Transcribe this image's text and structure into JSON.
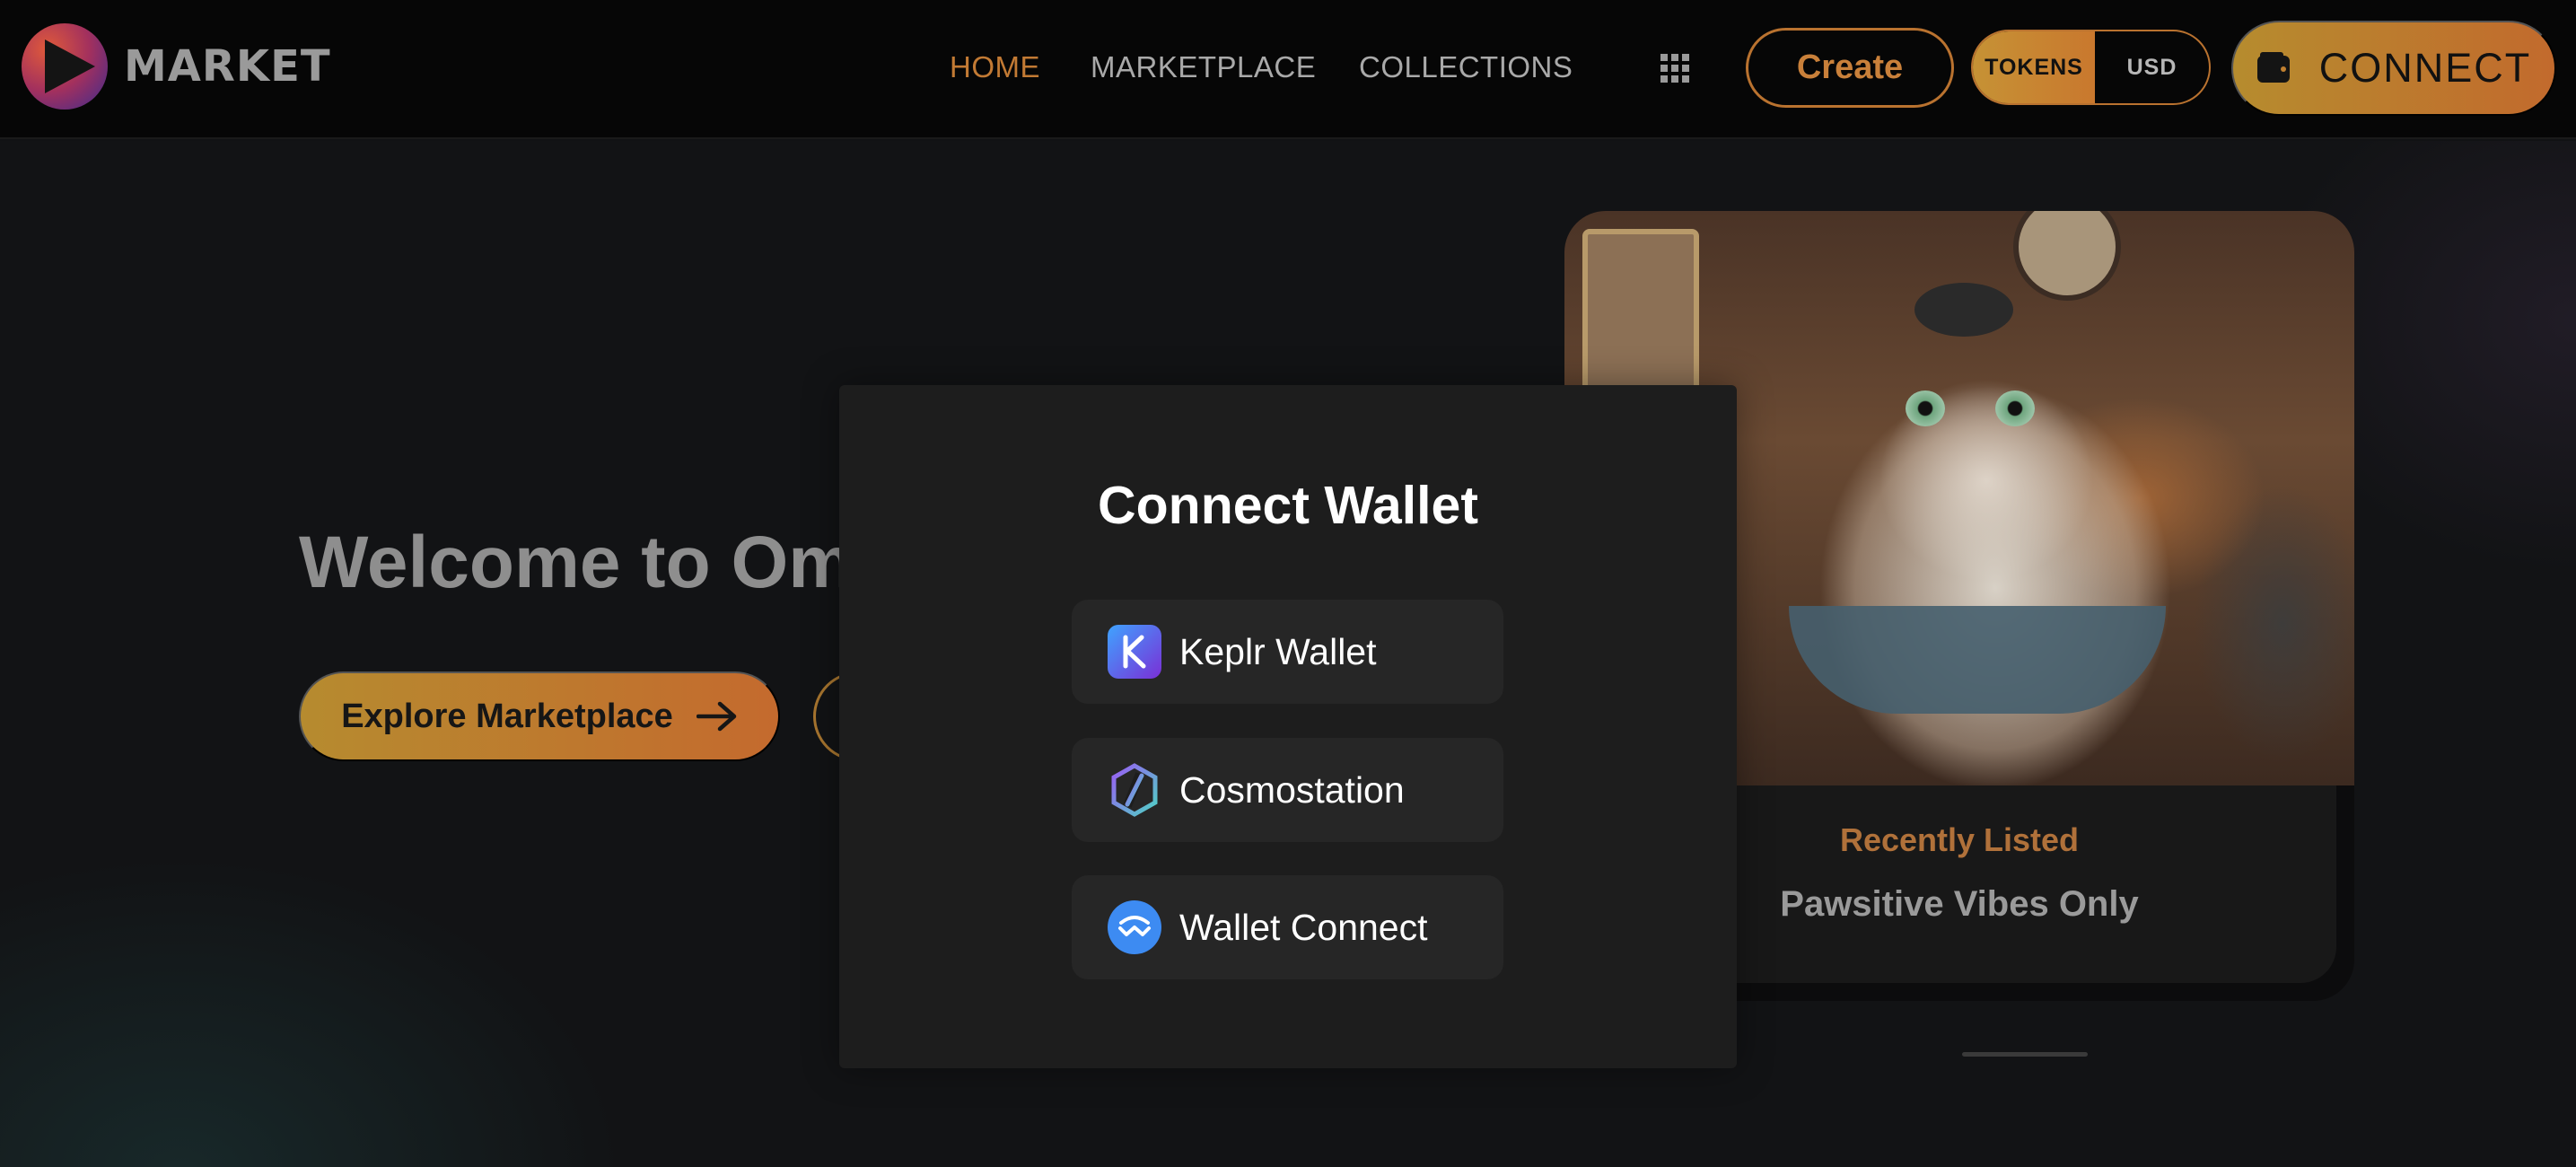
{
  "header": {
    "brand": "MARKET",
    "nav": [
      {
        "label": "HOME",
        "active": true
      },
      {
        "label": "MARKETPLACE",
        "active": false
      },
      {
        "label": "COLLECTIONS",
        "active": false
      }
    ],
    "create_label": "Create",
    "currency_toggle": {
      "tokens": "TOKENS",
      "usd": "USD",
      "selected": "TOKENS"
    },
    "connect_label": "CONNECT",
    "icons": {
      "logo": "play-logo-icon",
      "apps": "grid-icon",
      "wallet": "wallet-icon"
    }
  },
  "hero": {
    "title": "Welcome to Om",
    "explore_label": "Explore Marketplace",
    "explore_icon": "arrow-right-icon"
  },
  "featured_card": {
    "tag": "Recently Listed",
    "name": "Pawsitive Vibes Only"
  },
  "modal": {
    "title": "Connect Wallet",
    "wallets": [
      {
        "label": "Keplr Wallet",
        "icon": "keplr-icon"
      },
      {
        "label": "Cosmostation",
        "icon": "cosmostation-icon"
      },
      {
        "label": "Wallet Connect",
        "icon": "walletconnect-icon"
      }
    ]
  },
  "colors": {
    "accent": "#c27a34",
    "gradient_start": "#b68c2e",
    "gradient_end": "#c26a2d",
    "background": "#121315",
    "modal_bg": "#1d1d1d",
    "wallet_button_bg": "#262626"
  }
}
